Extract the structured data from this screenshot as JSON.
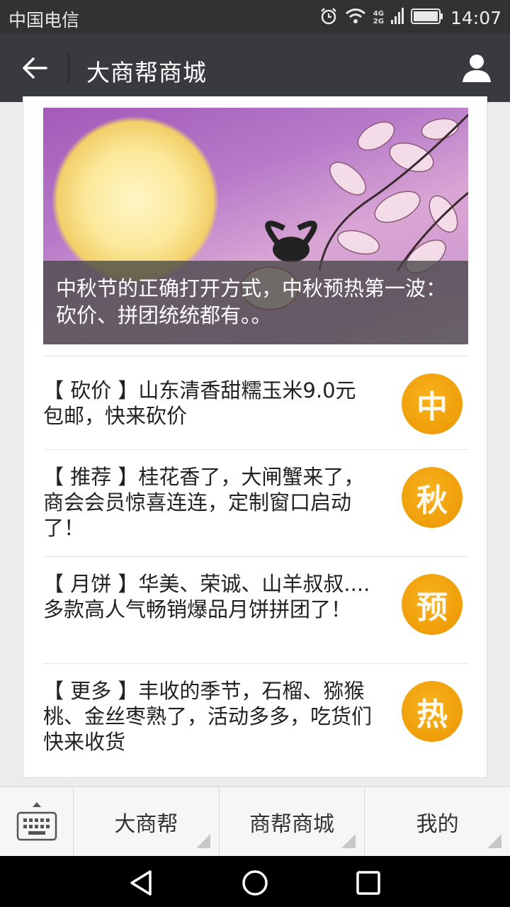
{
  "status": {
    "carrier": "中国电信",
    "time": "14:07",
    "net_top": "4G",
    "net_bottom": "2G"
  },
  "titlebar": {
    "title": "大商帮商城"
  },
  "banner": {
    "caption": "中秋节的正确打开方式，中秋预热第一波：砍价、拼团统统都有。。"
  },
  "articles": [
    {
      "text": "【 砍价 】山东清香甜糯玉米9.0元包邮，快来砍价",
      "thumb": "中"
    },
    {
      "text": "【 推荐 】桂花香了，大闸蟹来了，商会会员惊喜连连，定制窗口启动了！",
      "thumb": "秋"
    },
    {
      "text": "【 月饼 】华美、荣诚、山羊叔叔....多款高人气畅销爆品月饼拼团了！",
      "thumb": "预"
    },
    {
      "text": "【 更多 】丰收的季节，石榴、猕猴桃、金丝枣熟了，活动多多，吃货们快来收货",
      "thumb": "热"
    }
  ],
  "menu": {
    "items": [
      {
        "label": "大商帮"
      },
      {
        "label": "商帮商城"
      },
      {
        "label": "我的"
      }
    ]
  },
  "colors": {
    "titlebar_bg": "#393a3f",
    "status_bg": "#323232",
    "thumb_orange": "#f0a10b"
  }
}
